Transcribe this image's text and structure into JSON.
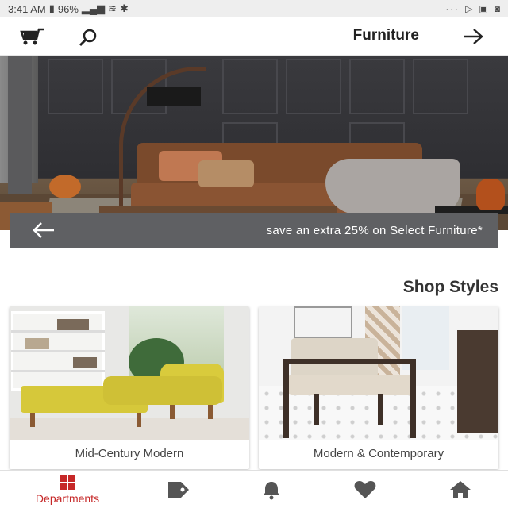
{
  "status_bar": {
    "time": "3:41 AM",
    "battery": "96%",
    "more_indicator": "···",
    "left_icons": [
      "battery-icon",
      "signal-icon",
      "wifi-icon",
      "bluetooth-icon"
    ],
    "right_icons": [
      "gallery-icon",
      "message-icon",
      "outlook-icon"
    ]
  },
  "app_bar": {
    "title": "Furniture",
    "icons": [
      "cart-icon",
      "search-icon",
      "back-arrow-icon"
    ]
  },
  "promo": {
    "text": "save an extra 25% on Select Furniture*",
    "icon": "arrow-icon"
  },
  "shop_styles": {
    "title": "Shop Styles",
    "cards": [
      {
        "label": "Mid-Century Modern"
      },
      {
        "label": "Modern & Contemporary"
      }
    ]
  },
  "bottom_nav": {
    "departments_label": "Departments",
    "items": [
      "departments-icon",
      "deals-tag-icon",
      "notifications-bell-icon",
      "favorites-heart-icon",
      "home-icon"
    ],
    "active": "departments",
    "accent_color": "#c62828"
  },
  "colors": {
    "promo_bg": "#5f6063",
    "status_bg": "#eeeeee",
    "accent": "#c62828"
  }
}
